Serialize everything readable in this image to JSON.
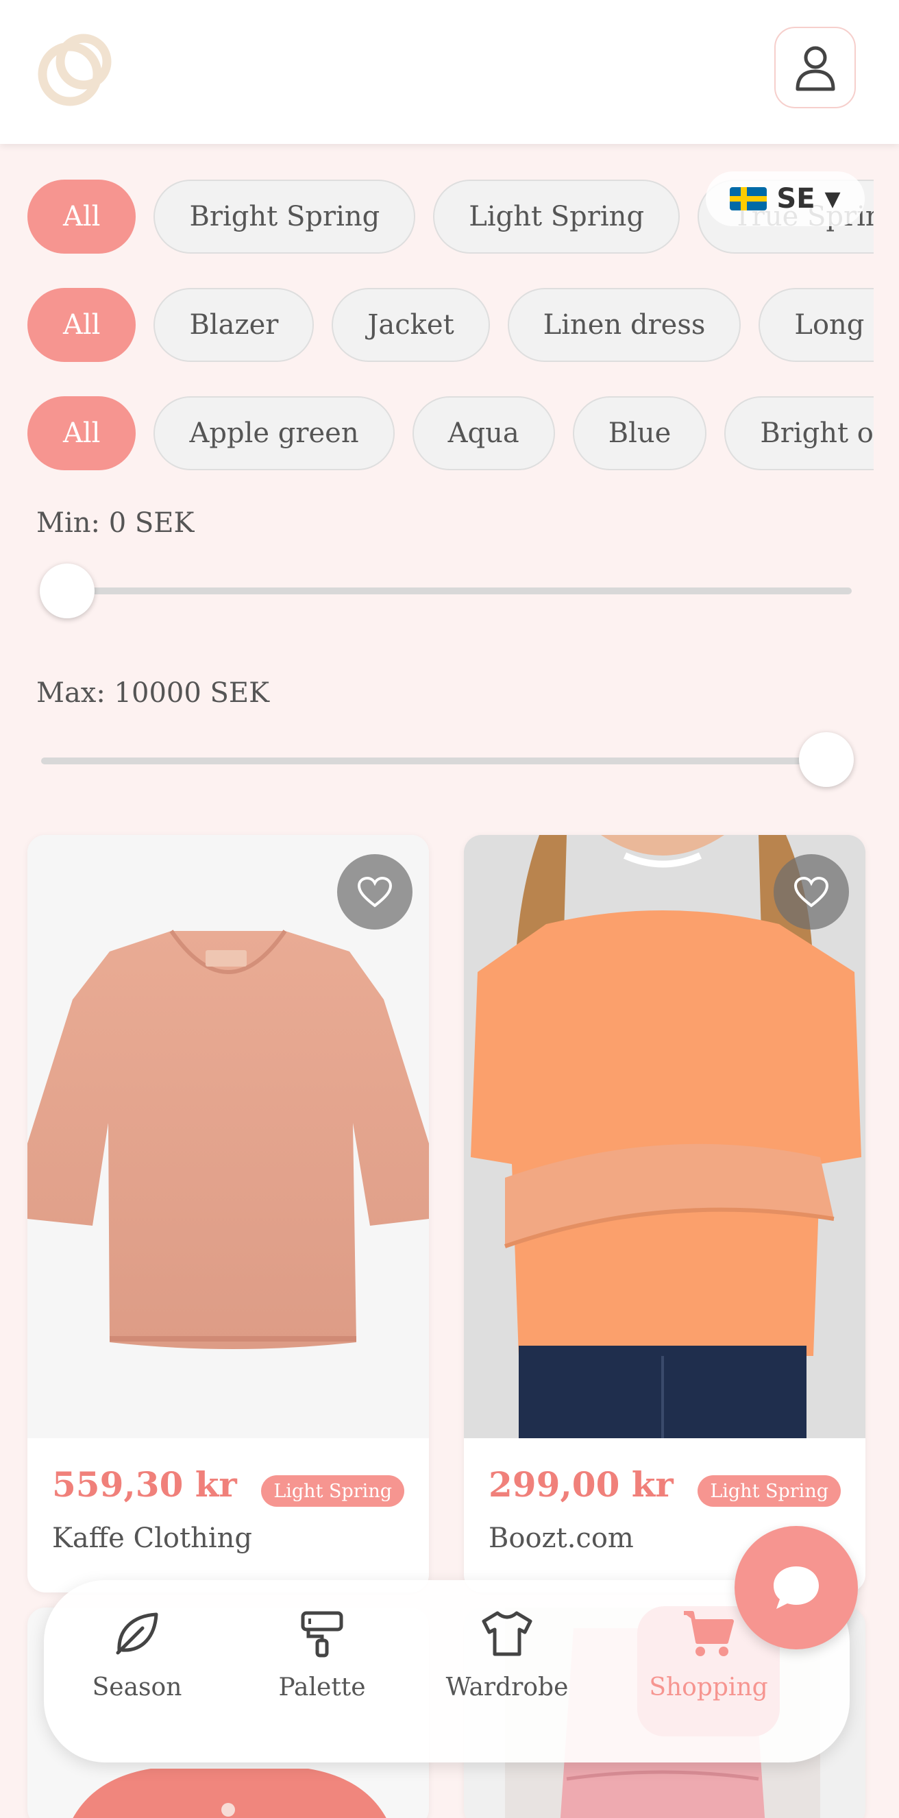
{
  "header": {
    "logo_icon": "rings-logo-icon",
    "profile_icon": "user-icon"
  },
  "language": {
    "flag_icon": "sweden-flag-icon",
    "code": "SE",
    "caret": "▼"
  },
  "filters": {
    "seasons": [
      "All",
      "Bright Spring",
      "Light Spring",
      "True Spring"
    ],
    "categories": [
      "All",
      "Blazer",
      "Jacket",
      "Linen dress",
      "Long dress"
    ],
    "colors": [
      "All",
      "Apple green",
      "Aqua",
      "Blue",
      "Bright orange"
    ]
  },
  "price_filter": {
    "min_label": "Min: 0 SEK",
    "max_label": "Max: 10000 SEK",
    "min_value_fraction": 0,
    "max_value_fraction": 1
  },
  "products": [
    {
      "price": "559,30 kr",
      "badge": "Light Spring",
      "brand": "Kaffe Clothing",
      "image": "peach knit sweater"
    },
    {
      "price": "299,00 kr",
      "badge": "Light Spring",
      "brand": "Boozt.com",
      "image": "woman in orange t-shirt"
    }
  ],
  "bottom_nav": [
    {
      "label": "Season",
      "icon": "leaf-icon"
    },
    {
      "label": "Palette",
      "icon": "paint-roller-icon"
    },
    {
      "label": "Wardrobe",
      "icon": "tshirt-icon"
    },
    {
      "label": "Shopping",
      "icon": "shopping-cart-icon",
      "active": true
    }
  ],
  "colors": {
    "accent": "#f69590",
    "price_text": "#f0807a",
    "background": "#fdf2f1",
    "chip_bg": "#f2f2f2"
  },
  "chat_icon": "chat-bubble-icon"
}
